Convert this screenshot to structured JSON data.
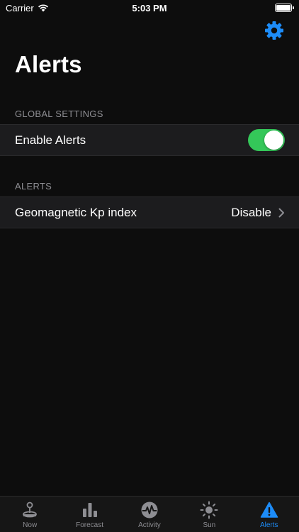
{
  "status_bar": {
    "carrier": "Carrier",
    "time": "5:03 PM"
  },
  "header": {
    "title": "Alerts",
    "settings_icon": "gear-icon"
  },
  "global_settings": {
    "section_title": "GLOBAL SETTINGS",
    "enable_alerts": {
      "label": "Enable Alerts",
      "on": true
    }
  },
  "alerts": {
    "section_title": "ALERTS",
    "items": [
      {
        "label": "Geomagnetic Kp index",
        "value": "Disable"
      }
    ]
  },
  "tab_bar": {
    "tabs": [
      {
        "label": "Now",
        "icon": "joystick-icon",
        "active": false
      },
      {
        "label": "Forecast",
        "icon": "bar-chart-icon",
        "active": false
      },
      {
        "label": "Activity",
        "icon": "activity-icon",
        "active": false
      },
      {
        "label": "Sun",
        "icon": "sun-icon",
        "active": false
      },
      {
        "label": "Alerts",
        "icon": "warning-icon",
        "active": true
      }
    ]
  },
  "colors": {
    "accent": "#1d8cf8",
    "toggle_on": "#34c759",
    "background": "#0d0d0d",
    "row_background": "#1c1c1e",
    "secondary_text": "#8e8e93"
  }
}
